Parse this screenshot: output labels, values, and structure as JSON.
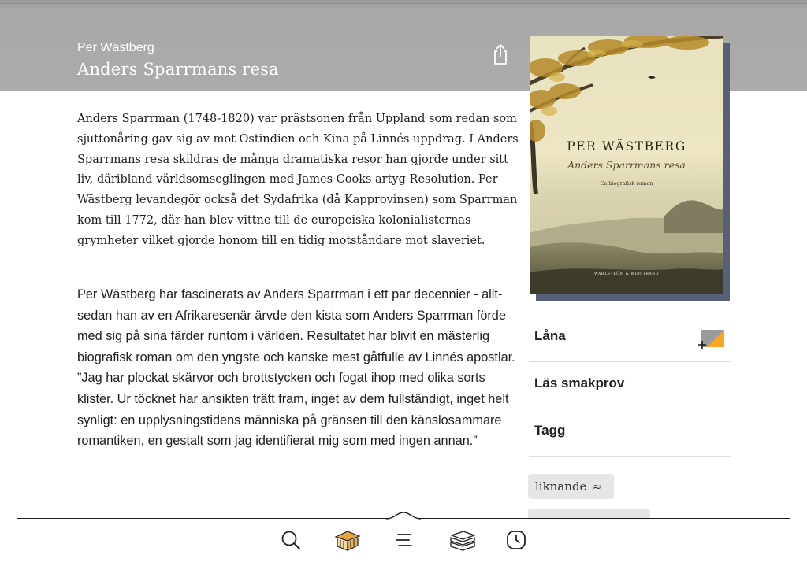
{
  "book": {
    "author": "Per Wästberg",
    "title": "Anders Sparrmans resa"
  },
  "description": {
    "paragraph1": "Anders Sparrman (1748-1820) var prästsonen från Uppland som redan som sjuttonåring gav sig av mot Ostindien och Kina på Linnés uppdrag. I Anders Sparrmans resa skildras de många dramatiska resor han gjorde under sitt liv, däribland världsomseglingen med James Cooks artyg Reso­lution. Per Wästberg levandegör också det Sydafrika (då Kapprovinsen) som Sparrman kom till 1772, där han blev vittne till de europeiska kolonia­listernas grymheter vilket gjorde honom till en tidig motståndare mot sla­veriet.",
    "paragraph2": "Per Wästberg har fascinerats av Anders Sparrman i ett par decennier - allt­sedan han av en Afrikaresenär ärvde den kista som Anders Sparrman förde med sig på sina färder runtom i världen. Resultatet har blivit en mästerlig biografisk roman om den yngste och kanske mest gåtfulle av Linnés apost­lar. ”Jag har plockat skärvor och brottstycken och fogat ihop med olika sorts klister. Ur töcknet har ansikten trätt fram, inget av dem fullständigt, inget helt synligt: en upplysningstidens människa på gränsen till den käns­losammare romantiken, en gestalt som jag identifierat mig som med ingen annan.”"
  },
  "cover": {
    "author": "PER WÄSTBERG",
    "title": "Anders Sparrmans resa",
    "subtitle": "En biografisk roman",
    "publisher": "WAHLSTRÖM & WIDSTRAND"
  },
  "actions": {
    "borrow": "Låna",
    "sample": "Läs smakprov",
    "tags": "Tagg"
  },
  "similar": {
    "label": "liknande",
    "symbol": "≈"
  },
  "icons": {
    "share": "share-icon",
    "borrow": "borrow-icon",
    "search": "search-icon",
    "library": "library-icon",
    "menu": "menu-icon",
    "books": "books-icon",
    "history": "clock-icon"
  },
  "colors": {
    "header": "#ababab",
    "borrow_orange": "#f7a823",
    "borrow_gray": "#9b9b9b",
    "cover_shadow": "#585f78"
  }
}
